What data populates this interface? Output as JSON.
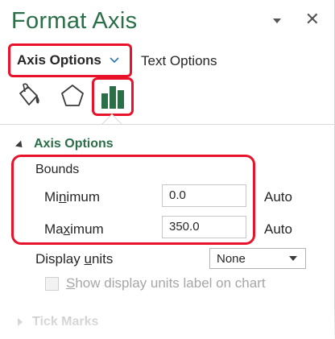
{
  "pane": {
    "title": "Format Axis"
  },
  "tabs": {
    "axis_options": "Axis Options",
    "text_options": "Text Options"
  },
  "icons": {
    "fill_line": "paint-bucket-icon",
    "effects": "pentagon-icon",
    "axis_options": "bar-chart-icon"
  },
  "section": {
    "title": "Axis Options"
  },
  "bounds": {
    "label": "Bounds",
    "minimum": {
      "label_pre": "Mi",
      "label_u": "n",
      "label_post": "imum",
      "value": "0.0",
      "auto": "Auto"
    },
    "maximum": {
      "label_pre": "Ma",
      "label_u": "x",
      "label_post": "imum",
      "value": "350.0",
      "auto": "Auto"
    }
  },
  "display_units": {
    "label_pre": "Display ",
    "label_u": "u",
    "label_post": "nits",
    "value": "None"
  },
  "show_units_label": {
    "label_u": "S",
    "label_post": "how display units label on chart"
  },
  "collapsed_section": {
    "title": "Tick Marks"
  },
  "colors": {
    "accent_green": "#2a6f48",
    "highlight_red": "#e8132b"
  }
}
